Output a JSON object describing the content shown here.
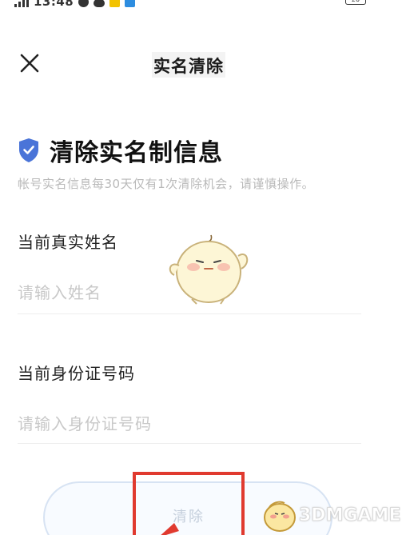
{
  "status_bar": {
    "time": "13:48",
    "battery": "20",
    "icons": [
      "signal-icon",
      "status-notification-icon",
      "cloud-icon",
      "app-icon",
      "app-icon",
      "wifi-icon",
      "battery-icon"
    ]
  },
  "nav": {
    "title": "实名清除",
    "close_icon": "close-icon"
  },
  "section": {
    "icon": "shield-check-icon",
    "heading": "清除实名制信息",
    "hint": "帐号实名信息每30天仅有1次清除机会，请谨慎操作。"
  },
  "form": {
    "name_label": "当前真实姓名",
    "name_placeholder": "请输入姓名",
    "id_label": "当前身份证号码",
    "id_placeholder": "请输入身份证号码"
  },
  "actions": {
    "clear_label": "清除"
  },
  "watermark": {
    "text": "3DMGAME"
  },
  "colors": {
    "shield": "#4a74d8",
    "annotation_red": "#e03a2f",
    "button_border": "#d7e3f3",
    "placeholder": "#c8c8c8"
  }
}
